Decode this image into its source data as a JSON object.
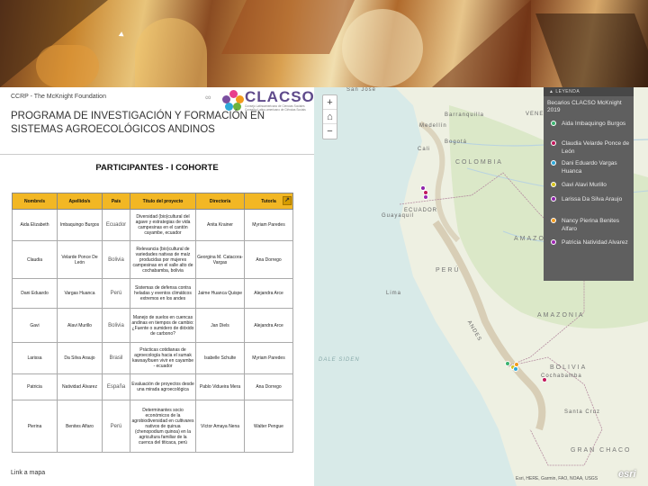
{
  "header": {
    "org": "CCRP - The McKnight Foundation",
    "logo_name": "CLACSO",
    "logo_sub": "Consejo Latinoamericano de Ciencias Sociales Conselho Latino-americano de Ciências Sociais",
    "program_title": "PROGRAMA DE INVESTIGACIÓN Y FORMACIÓN EN SISTEMAS AGROECOLÓGICOS ANDINOS",
    "participants_title": "PARTICIPANTES - I COHORTE"
  },
  "table": {
    "headers": [
      "Nombre/s",
      "Apellido/s",
      "País",
      "Título del proyecto",
      "Director/a",
      "Tutor/a"
    ],
    "rows": [
      [
        "Aida Elizabeth",
        "Imbaquingo Burgos",
        "Ecuador",
        "Diversidad (bio)cultural del agave y estrategias de vida campesinas en el cantón cayambe, ecuador",
        "Anita Krainer",
        "Myriam Paredes"
      ],
      [
        "Claudia",
        "Velarde Ponce De León",
        "Bolivia",
        "Relevancia (bio)cultural de variedades nativas de maíz producidas por mujeres campesinas en el valle alto de cochabamba, bolivia",
        "Georgina M. Catacora-Vargas",
        "Ana Dorrego"
      ],
      [
        "Dani Eduardo",
        "Vargas Huanca",
        "Perú",
        "Sistemas de defensa contra heladas y eventos climáticos extremos en los andes",
        "Jaime Huanca Quispe",
        "Alejandra Arce"
      ],
      [
        "Gavi",
        "Alavi Murillo",
        "Bolivia",
        "Manejo de suelos en cuencas andinas en tiempos de cambio: ¿Fuente o sumidero de dióxido de carbono?",
        "Jan Diels",
        "Alejandra Arce"
      ],
      [
        "Larissa",
        "Da Silva Araujo",
        "Brasil",
        "Prácticas cotidianas de agroecología hacia el sumak kawsay/buen vivir en cayambe - ecuador",
        "Isabelle Schulte",
        "Myriam Paredes"
      ],
      [
        "Patricia",
        "Natividad Álvarez",
        "España",
        "Evaluación de proyectos desde una mirada agroecológica",
        "Pablo Vidueira Mera",
        "Ana Dorrego"
      ],
      [
        "Pierina",
        "Benites Alfaro",
        "Perú",
        "Determinantes socio económicos de la agrobiodiversidad en cultivares nativos de quinua (chenopodium quinoa) en la agricultura familiar de la cuenca del titicaca, perú",
        "Víctor Amaya Nena",
        "Walter Pengue"
      ]
    ]
  },
  "link_map": "Link a mapa",
  "map": {
    "legend_header": "LEYENDA",
    "legend_subtitle": "Becarios CLACSO McKnight 2019",
    "legend_items": [
      {
        "name": "Aida Imbaquingo Burgos",
        "color": "#3cb371"
      },
      {
        "name": "Claudia Velarde Ponce de León",
        "color": "#c2185b"
      },
      {
        "name": "Dani Eduardo Vargas Huanca",
        "color": "#2ea8d8"
      },
      {
        "name": "Gavi Alavi Murillo",
        "color": "#d4c21c"
      },
      {
        "name": "Larissa Da Silva Araujo",
        "color": "#8e24aa"
      },
      {
        "name": "Nancy Pierina Benites Alfaro",
        "color": "#f29b1d"
      },
      {
        "name": "Patricia Natividad Alvarez",
        "color": "#9c27b0"
      }
    ],
    "labels": {
      "colombia": "COLOMBIA",
      "ecuador": "ECUADOR",
      "peru": "PERÚ",
      "bolivia": "BOLIVIA",
      "amazonas": "AMAZONAS",
      "amazonia": "AMAZONIA",
      "chaco": "GRAN CHACO",
      "andes": "ANDES",
      "venez": "VENE",
      "cali": "Cali",
      "medellin": "Medellín",
      "bogota": "Bogotá",
      "guayaquil": "Guayaquil",
      "lima": "Lima",
      "cochabamba": "Cochabamba",
      "santa_cruz": "Santa Cruz",
      "dale": "DALE SIDEN",
      "san_jose": "San José",
      "barranquilla": "Barranquilla"
    },
    "attribution": "Esri, HERE, Garmin, FAO, NOAA, USGS",
    "esri": "esri"
  }
}
